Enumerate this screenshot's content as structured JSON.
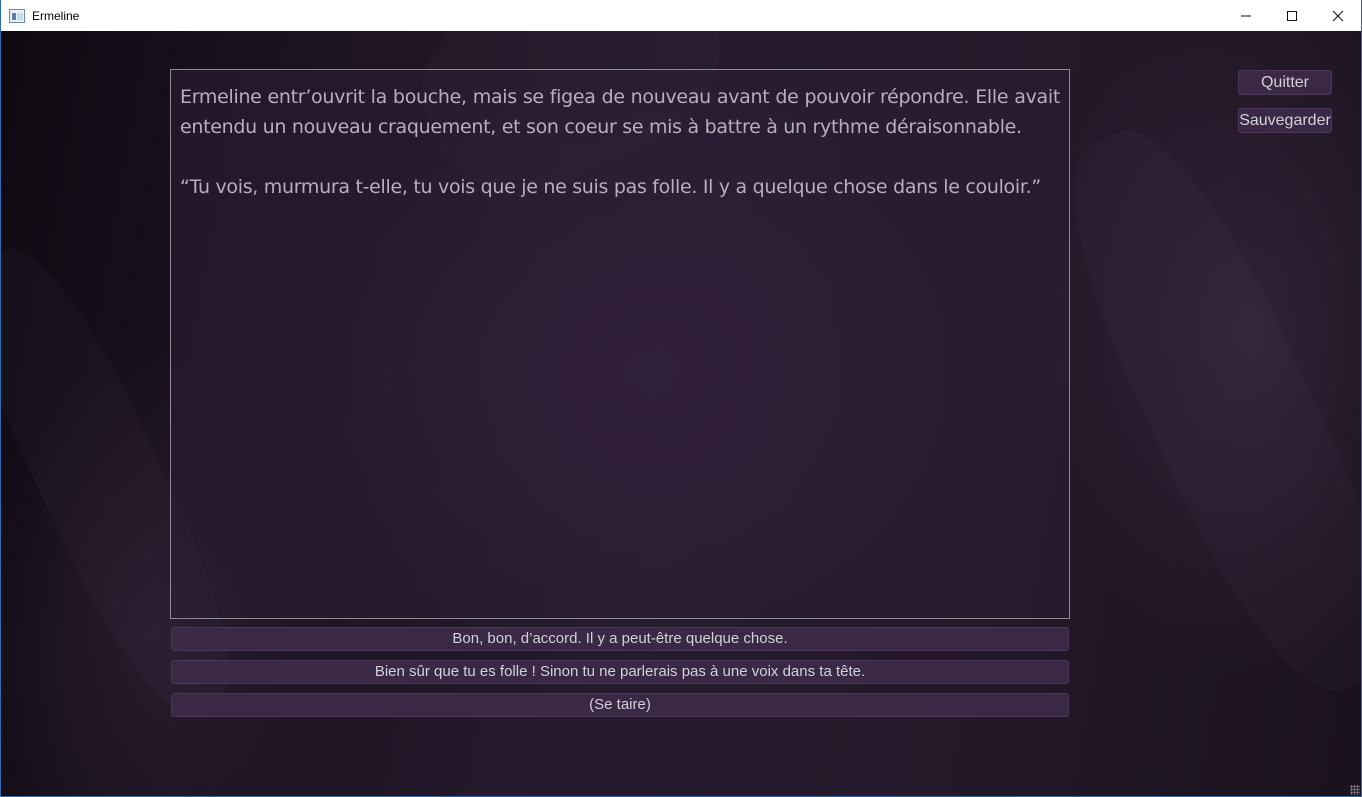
{
  "window": {
    "title": "Ermeline",
    "controls": {
      "minimize": "—",
      "maximize": "☐",
      "close": "✕"
    }
  },
  "story": {
    "paragraphs": [
      "Ermeline entr’ouvrit la bouche, mais se figea de nouveau avant de pouvoir répondre. Elle avait entendu un nouveau craquement, et son coeur se mis à battre à un rythme déraisonnable.",
      "“Tu vois, murmura t-elle, tu vois que je ne suis pas folle. Il y a quelque chose dans le couloir.”"
    ]
  },
  "choices": [
    "Bon, bon, d’accord. Il y a peut-être quelque chose.",
    "Bien sûr que tu es folle ! Sinon tu ne parlerais pas à une voix dans ta tête.",
    "(Se taire)"
  ],
  "menu": {
    "quit_label": "Quitter",
    "save_label": "Sauvegarder"
  },
  "colors": {
    "text": "#b7aebf",
    "button_bg": "#3b2844",
    "button_text": "#d6cfdd",
    "box_border": "#8f8798"
  }
}
